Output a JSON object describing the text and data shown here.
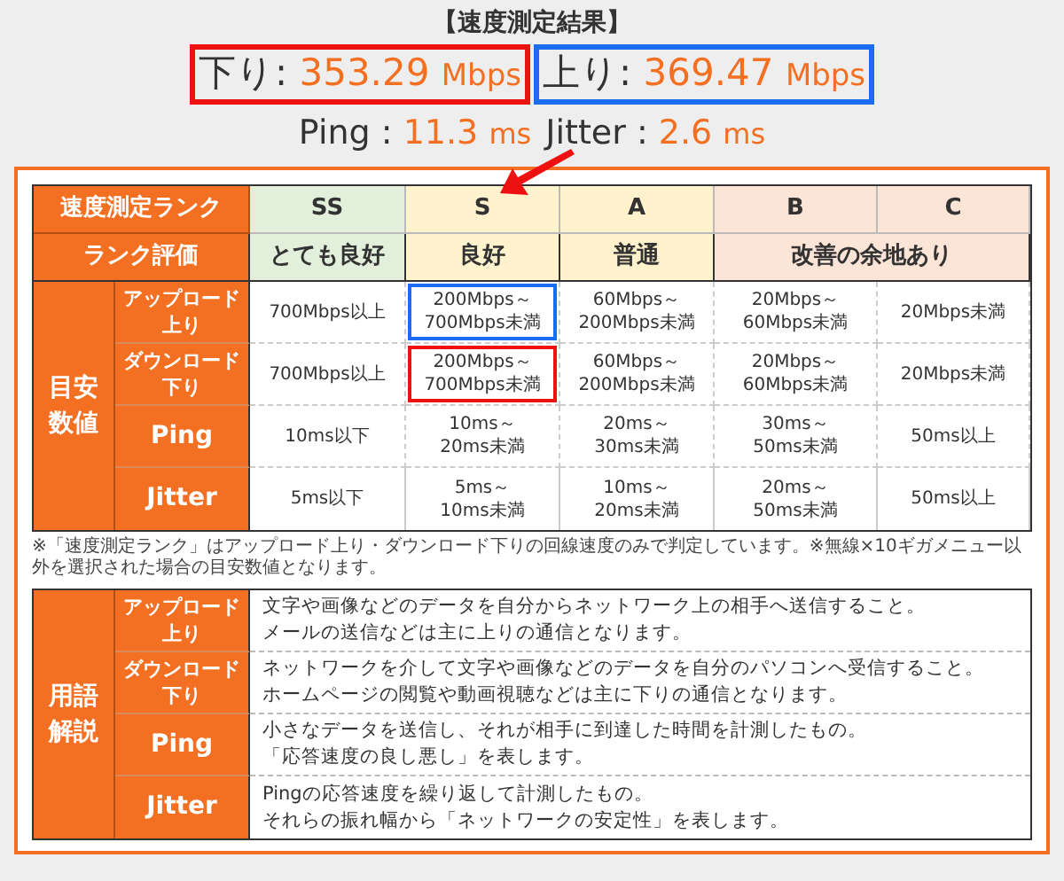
{
  "title": "【速度測定結果】",
  "results": [
    {
      "label": "下り",
      "separator": ":",
      "value": "353.29",
      "unit": "Mbps",
      "color": "#ee1111"
    },
    {
      "label": "上り",
      "separator": ":",
      "value": "369.47",
      "unit": "Mbps",
      "color": "#1a6cf0"
    }
  ],
  "latency": [
    {
      "label": "Ping",
      "separator": ":",
      "value": "11.3",
      "unit": "ms"
    },
    {
      "label": "Jitter",
      "separator": ":",
      "value": "2.6",
      "unit": "ms"
    }
  ],
  "rank_table": {
    "header_label": "速度測定ランク",
    "ranks": [
      {
        "label": "SS",
        "color": "#e2efda"
      },
      {
        "label": "S",
        "color": "#fff2cc"
      },
      {
        "label": "A",
        "color": "#fff2cc"
      },
      {
        "label": "B",
        "color": "#fce4d6"
      },
      {
        "label": "C",
        "color": "#fce4d6"
      }
    ],
    "rating_label": "ランク評価",
    "ratings": [
      "とても良好",
      "良好",
      "普通",
      "改善の余地あり"
    ],
    "group_label": "目安数値",
    "rows": [
      {
        "label": [
          "アップロード",
          "上り"
        ],
        "cells": [
          {
            "text": "700Mbps以上"
          },
          {
            "text": "200Mbps～\n700Mbps未満",
            "color": "#1a6cf0"
          },
          {
            "text": "60Mbps～\n200Mbps未満"
          },
          {
            "text": "20Mbps～\n60Mbps未満"
          },
          {
            "text": "20Mbps未満"
          }
        ]
      },
      {
        "label": [
          "ダウンロード",
          "下り"
        ],
        "cells": [
          {
            "text": "700Mbps以上"
          },
          {
            "text": "200Mbps～\n700Mbps未満",
            "color": "#ee1111"
          },
          {
            "text": "60Mbps～\n200Mbps未満"
          },
          {
            "text": "20Mbps～\n60Mbps未満"
          },
          {
            "text": "20Mbps未満"
          }
        ]
      },
      {
        "label": [
          "Ping"
        ],
        "cells": [
          {
            "text": "10ms以下"
          },
          {
            "text": "10ms～\n20ms未満"
          },
          {
            "text": "20ms～\n30ms未満"
          },
          {
            "text": "30ms～\n50ms未満"
          },
          {
            "text": "50ms以上"
          }
        ]
      },
      {
        "label": [
          "Jitter"
        ],
        "cells": [
          {
            "text": "5ms以下"
          },
          {
            "text": "5ms～\n10ms未満"
          },
          {
            "text": "10ms～\n20ms未満"
          },
          {
            "text": "20ms～\n50ms未満"
          },
          {
            "text": "50ms以上"
          }
        ]
      }
    ]
  },
  "footnote": "※「速度測定ランク」はアップロード上り・ダウンロード下りの回線速度のみで判定しています。※無線×10ギガメニュー以外を選択された場合の目安数値となります。",
  "glossary": {
    "group_label": "用語解説",
    "rows": [
      {
        "term": [
          "アップロード",
          "上り"
        ],
        "description": [
          "文字や画像などのデータを自分からネットワーク上の相手へ送信すること。",
          "メールの送信などは主に上りの通信となります。"
        ]
      },
      {
        "term": [
          "ダウンロード",
          "下り"
        ],
        "description": [
          "ネットワークを介して文字や画像などのデータを自分のパソコンへ受信すること。",
          "ホームページの閲覧や動画視聴などは主に下りの通信となります。"
        ]
      },
      {
        "term": [
          "Ping"
        ],
        "description": [
          "小さなデータを送信し、それが相手に到達した時間を計測したもの。",
          "「応答速度の良し悪し」を表します。"
        ]
      },
      {
        "term": [
          "Jitter"
        ],
        "description": [
          "Pingの応答速度を繰り返して計測したもの。",
          "それらの振れ幅から「ネットワークの安定性」を表します。"
        ]
      }
    ]
  }
}
